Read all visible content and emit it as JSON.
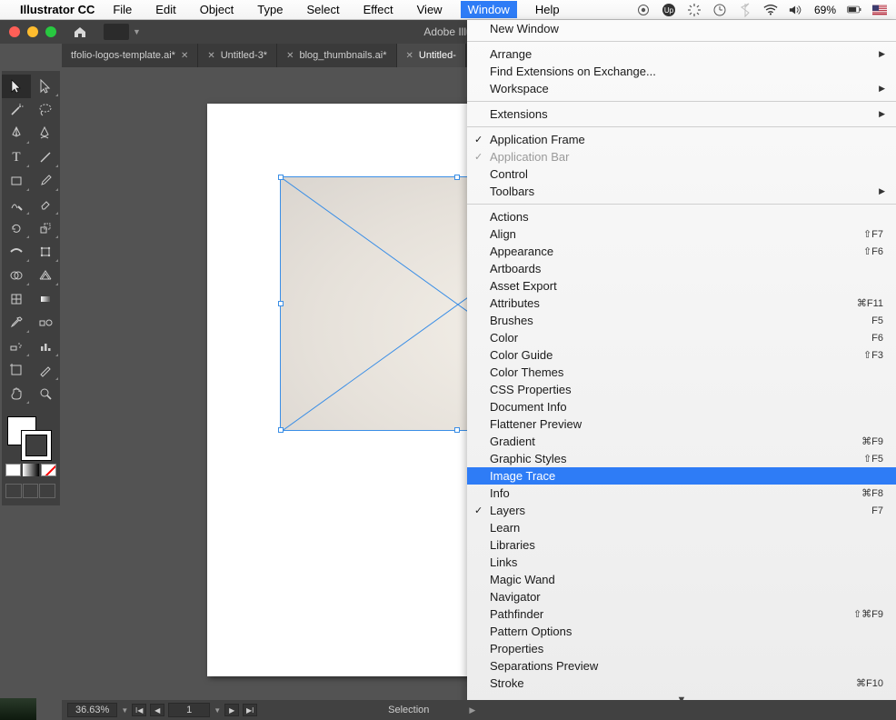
{
  "menubar": {
    "apple": "",
    "app": "Illustrator CC",
    "items": [
      "File",
      "Edit",
      "Object",
      "Type",
      "Select",
      "Effect",
      "View",
      "Window",
      "Help"
    ],
    "active": "Window",
    "battery": "69%"
  },
  "window_title": "Adobe Illu",
  "tabs": [
    {
      "label": "tfolio-logos-template.ai*",
      "active": false
    },
    {
      "label": "Untitled-3*",
      "active": false
    },
    {
      "label": "blog_thumbnails.ai*",
      "active": false
    },
    {
      "label": "Untitled-",
      "active": true
    }
  ],
  "dropdown": {
    "group1": [
      {
        "label": "New Window"
      }
    ],
    "group2": [
      {
        "label": "Arrange",
        "sub": true
      },
      {
        "label": "Find Extensions on Exchange..."
      },
      {
        "label": "Workspace",
        "sub": true
      }
    ],
    "group3": [
      {
        "label": "Extensions",
        "sub": true
      }
    ],
    "group4": [
      {
        "label": "Application Frame",
        "checked": true
      },
      {
        "label": "Application Bar",
        "checked": true,
        "disabled": true
      },
      {
        "label": "Control"
      },
      {
        "label": "Toolbars",
        "sub": true
      }
    ],
    "group5": [
      {
        "label": "Actions"
      },
      {
        "label": "Align",
        "short": "⇧F7"
      },
      {
        "label": "Appearance",
        "short": "⇧F6"
      },
      {
        "label": "Artboards"
      },
      {
        "label": "Asset Export"
      },
      {
        "label": "Attributes",
        "short": "⌘F11"
      },
      {
        "label": "Brushes",
        "short": "F5"
      },
      {
        "label": "Color",
        "short": "F6"
      },
      {
        "label": "Color Guide",
        "short": "⇧F3"
      },
      {
        "label": "Color Themes"
      },
      {
        "label": "CSS Properties"
      },
      {
        "label": "Document Info"
      },
      {
        "label": "Flattener Preview"
      },
      {
        "label": "Gradient",
        "short": "⌘F9"
      },
      {
        "label": "Graphic Styles",
        "short": "⇧F5"
      },
      {
        "label": "Image Trace",
        "selected": true
      },
      {
        "label": "Info",
        "short": "⌘F8"
      },
      {
        "label": "Layers",
        "short": "F7",
        "checked": true
      },
      {
        "label": "Learn"
      },
      {
        "label": "Libraries"
      },
      {
        "label": "Links"
      },
      {
        "label": "Magic Wand"
      },
      {
        "label": "Navigator"
      },
      {
        "label": "Pathfinder",
        "short": "⇧⌘F9"
      },
      {
        "label": "Pattern Options"
      },
      {
        "label": "Properties"
      },
      {
        "label": "Separations Preview"
      },
      {
        "label": "Stroke",
        "short": "⌘F10"
      }
    ],
    "more": "▼"
  },
  "status": {
    "zoom": "36.63%",
    "page": "1",
    "tool": "Selection"
  }
}
